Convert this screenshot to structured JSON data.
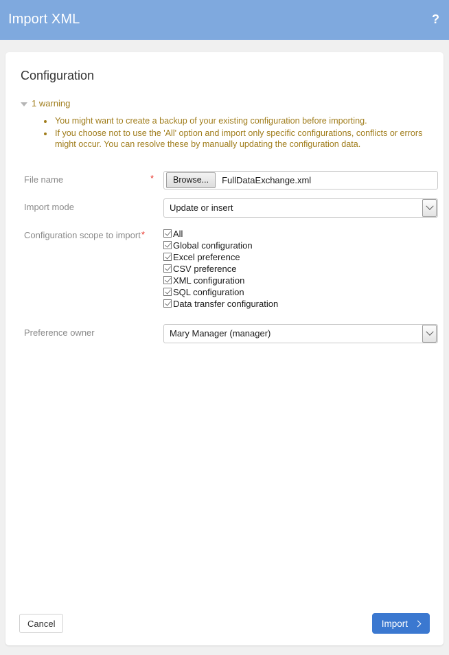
{
  "titlebar": {
    "title": "Import XML",
    "help_icon": "question-mark-icon",
    "help_label": "?",
    "background_color": "#7fa9de"
  },
  "card": {
    "section_title": "Configuration",
    "warning": {
      "toggle_icon": "triangle-down-icon",
      "summary": "1 warning",
      "color": "#a07d1c",
      "items": [
        "You might want to create a backup of your existing configuration before importing.",
        "If you choose not to use the 'All' option and import only specific configurations, conflicts or errors might occur. You can resolve these by manually updating the configuration data."
      ]
    },
    "form": {
      "file_name": {
        "label": "File name",
        "required_marker": "*",
        "browse_label": "Browse...",
        "value": "FullDataExchange.xml"
      },
      "import_mode": {
        "label": "Import mode",
        "value": "Update or insert",
        "options": [
          "Update or insert"
        ]
      },
      "scope": {
        "label": "Configuration scope to import",
        "required_marker": "*",
        "items": [
          {
            "label": "All",
            "checked": true
          },
          {
            "label": "Global configuration",
            "checked": true
          },
          {
            "label": "Excel preference",
            "checked": true
          },
          {
            "label": "CSV preference",
            "checked": true
          },
          {
            "label": "XML configuration",
            "checked": true
          },
          {
            "label": "SQL configuration",
            "checked": true
          },
          {
            "label": "Data transfer configuration",
            "checked": true
          }
        ]
      },
      "preference_owner": {
        "label": "Preference owner",
        "value": "Mary Manager (manager)",
        "options": [
          "Mary Manager (manager)"
        ]
      }
    },
    "footer": {
      "cancel_label": "Cancel",
      "import_label": "Import",
      "import_icon": "chevron-right-icon",
      "import_color": "#3b78d0"
    }
  }
}
